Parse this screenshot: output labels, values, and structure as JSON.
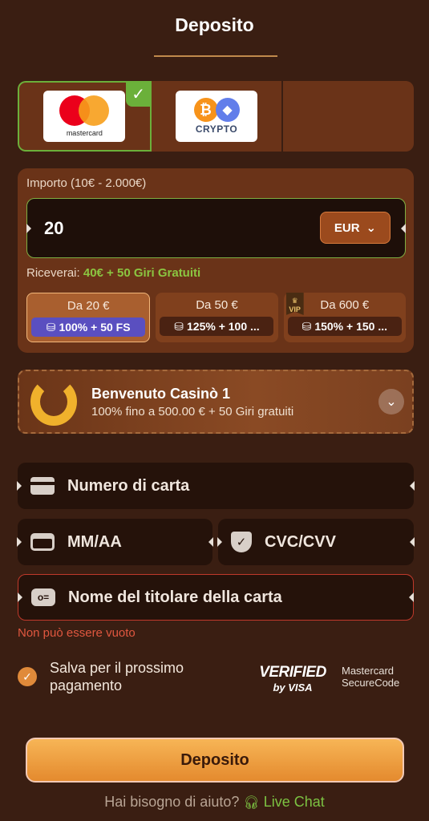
{
  "page": {
    "title": "Deposito"
  },
  "methods": {
    "mastercard_label": "mastercard",
    "crypto_label": "CRYPTO"
  },
  "amount": {
    "label": "Importo (10€ - 2.000€)",
    "value": "20",
    "currency": "EUR",
    "receive_prefix": "Riceverai:",
    "receive_value": "40€ + 50 Giri Gratuiti"
  },
  "bonus_options": [
    {
      "title": "Da 20 €",
      "reward": "100% + 50 FS",
      "active": true
    },
    {
      "title": "Da 50 €",
      "reward": "125% + 100 ...",
      "active": false
    },
    {
      "title": "Da 600 €",
      "reward": "150% + 150 ...",
      "active": false,
      "vip": "VIP"
    }
  ],
  "welcome": {
    "title": "Benvenuto Casinò 1",
    "subtitle": "100% fino a 500.00 € + 50 Giri gratuiti"
  },
  "card": {
    "number_placeholder": "Numero di carta",
    "expiry_placeholder": "MM/AA",
    "cvc_placeholder": "CVC/CVV",
    "holder_placeholder": "Nome del titolare della carta",
    "error": "Non può essere vuoto"
  },
  "save": {
    "label": "Salva per il prossimo pagamento",
    "checked": true
  },
  "security": {
    "verified_line1": "VERIFIED",
    "verified_line2": "by VISA",
    "mc_line1": "Mastercard",
    "mc_line2": "SecureCode"
  },
  "deposit_button": "Deposito",
  "help": {
    "question": "Hai bisogno di aiuto?",
    "chat": "Live Chat"
  },
  "colors": {
    "background": "#3a1e12",
    "panel": "#6a3318",
    "accent": "#e48a2e",
    "green": "#8bc541",
    "error": "#e0573f"
  }
}
